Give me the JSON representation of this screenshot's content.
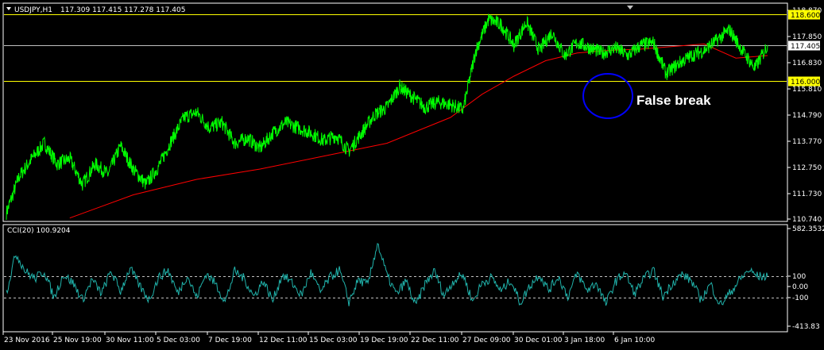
{
  "header": {
    "symbol": "USDJPY,H1",
    "ohlc": "117.309 117.415 117.278 117.405"
  },
  "indicator": {
    "label": "CCI(20) 100.9204",
    "scale_labels": [
      "582.3532",
      "100",
      "0.00",
      "-100",
      "-413.83"
    ]
  },
  "annotation": {
    "text": "False break"
  },
  "colors": {
    "background": "#000000",
    "price_line": "#00ff00",
    "moving_average": "#ff0000",
    "level_line": "#ffff00",
    "current_price": "#c0c0c0",
    "cci_line": "#20b2aa",
    "circle": "#0000ff",
    "grid": "#ffffff"
  },
  "chart_data": [
    {
      "type": "line",
      "title": "USDJPY,H1",
      "y_tick_labels": [
        "118.870",
        "117.850",
        "116.830",
        "115.810",
        "114.790",
        "113.770",
        "112.750",
        "111.730",
        "110.740"
      ],
      "ylim": [
        110.6,
        119.0
      ],
      "x_tick_labels": [
        "23 Nov 2016",
        "25 Nov 19:00",
        "30 Nov 11:00",
        "5 Dec 03:00",
        "7 Dec 19:00",
        "12 Dec 11:00",
        "15 Dec 03:00",
        "19 Dec 19:00",
        "22 Dec 11:00",
        "27 Dec 09:00",
        "30 Dec 01:00",
        "3 Jan 18:00",
        "6 Jan 10:00"
      ],
      "horizontal_levels": [
        {
          "value": 118.6,
          "label": "118.600"
        },
        {
          "value": 116.0,
          "label": "116.000"
        }
      ],
      "current_price": {
        "value": 117.405,
        "label": "117.405"
      },
      "series": [
        {
          "name": "price",
          "x": [
            0,
            0.4,
            0.8,
            1.2,
            1.6,
            2.0,
            2.4,
            2.8,
            3.2,
            3.6,
            4.0,
            4.4,
            4.8,
            5.2,
            5.6,
            6.0,
            6.4,
            6.8,
            7.2,
            7.6,
            8.0,
            8.4,
            8.8,
            9.2,
            9.6,
            10.0,
            10.4,
            10.8,
            11.2,
            11.6,
            12.0,
            12.4,
            12.8,
            13.2,
            13.6,
            14.0,
            14.4,
            14.8,
            15.2,
            15.6,
            16.0,
            16.4,
            16.8,
            17.2,
            17.6,
            18.0,
            18.4,
            18.8,
            19.2,
            19.6,
            20.0,
            20.4,
            20.8,
            21.2,
            21.6,
            22.0,
            22.4,
            22.8,
            23.2,
            23.6,
            24.0
          ],
          "values": [
            110.9,
            112.3,
            113.0,
            113.6,
            112.8,
            113.0,
            112.0,
            112.8,
            112.4,
            113.5,
            112.6,
            112.0,
            112.7,
            113.7,
            114.6,
            114.8,
            114.2,
            114.4,
            113.6,
            113.8,
            113.4,
            114.0,
            114.4,
            114.2,
            114.0,
            113.7,
            113.9,
            113.3,
            114.0,
            114.7,
            115.0,
            115.8,
            115.4,
            115.0,
            115.2,
            115.1,
            114.9,
            117.2,
            118.4,
            118.2,
            117.4,
            118.3,
            117.2,
            117.9,
            117.0,
            117.5,
            117.3,
            117.1,
            117.3,
            117.0,
            117.4,
            117.5,
            116.3,
            116.7,
            117.0,
            117.2,
            117.6,
            118.0,
            117.2,
            116.5,
            117.405
          ]
        },
        {
          "name": "moving average",
          "x": [
            2.0,
            4.0,
            6.0,
            8.0,
            10.0,
            12.0,
            14.0,
            15.0,
            16.0,
            17.0,
            18.0,
            19.0,
            20.0,
            21.0,
            22.0,
            23.0,
            24.0
          ],
          "values": [
            110.7,
            111.6,
            112.2,
            112.6,
            113.1,
            113.6,
            114.6,
            115.5,
            116.2,
            116.8,
            117.1,
            117.2,
            117.25,
            117.35,
            117.45,
            116.9,
            117.0
          ]
        }
      ]
    },
    {
      "type": "line",
      "title": "CCI(20) 100.9204",
      "y_tick_labels": [
        "582.3532",
        "100",
        "0.00",
        "-100",
        "-413.83"
      ],
      "ylim": [
        -413.83,
        582.35
      ],
      "levels": [
        100,
        -100
      ],
      "series": [
        {
          "name": "CCI(20)",
          "x": [
            0,
            0.3,
            0.6,
            0.9,
            1.2,
            1.5,
            1.8,
            2.1,
            2.4,
            2.7,
            3.0,
            3.3,
            3.6,
            3.9,
            4.2,
            4.5,
            4.8,
            5.1,
            5.4,
            5.7,
            6.0,
            6.3,
            6.6,
            6.9,
            7.2,
            7.5,
            7.8,
            8.1,
            8.4,
            8.7,
            9.0,
            9.3,
            9.6,
            9.9,
            10.2,
            10.5,
            10.8,
            11.1,
            11.4,
            11.7,
            12.0,
            12.3,
            12.6,
            12.9,
            13.2,
            13.5,
            13.8,
            14.1,
            14.4,
            14.7,
            15.0,
            15.3,
            15.6,
            15.9,
            16.2,
            16.5,
            16.8,
            17.1,
            17.4,
            17.7,
            18.0,
            18.3,
            18.6,
            18.9,
            19.2,
            19.5,
            19.8,
            20.1,
            20.4,
            20.7,
            21.0,
            21.3,
            21.6,
            21.9,
            22.2,
            22.5,
            22.8,
            23.1,
            23.4,
            23.7,
            24.0
          ],
          "values": [
            -50,
            320,
            150,
            80,
            150,
            -100,
            120,
            40,
            -120,
            70,
            -60,
            150,
            -40,
            180,
            10,
            -120,
            90,
            160,
            -60,
            110,
            -100,
            130,
            30,
            -140,
            150,
            80,
            -90,
            60,
            -130,
            120,
            40,
            -80,
            140,
            -50,
            90,
            160,
            -140,
            70,
            20,
            420,
            110,
            -70,
            60,
            -180,
            30,
            150,
            -80,
            60,
            120,
            -140,
            40,
            90,
            -40,
            70,
            -150,
            10,
            120,
            -30,
            100,
            -90,
            130,
            -30,
            40,
            -160,
            50,
            140,
            -60,
            80,
            160,
            -90,
            40,
            120,
            60,
            -120,
            30,
            -170,
            -60,
            60,
            160,
            100,
            101
          ]
        }
      ]
    }
  ]
}
